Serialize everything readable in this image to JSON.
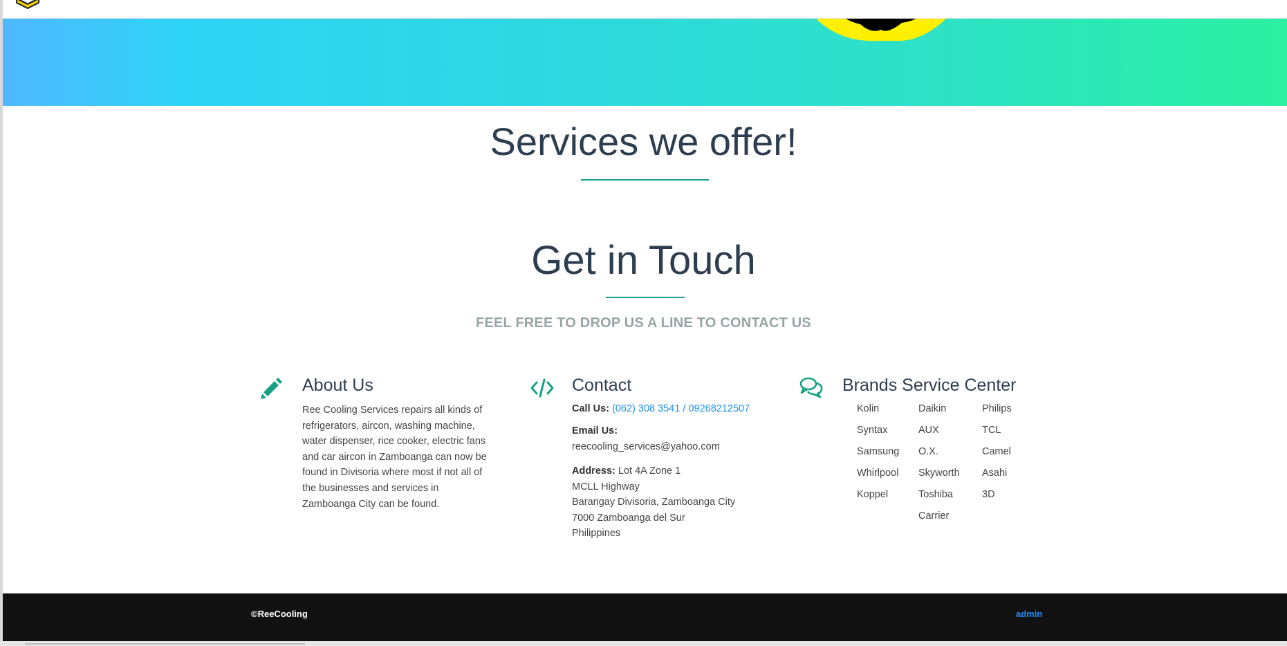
{
  "sections": {
    "services": {
      "title": "Services we offer!"
    },
    "contact": {
      "title": "Get in Touch",
      "subtitle": "FEEL FREE TO DROP US A LINE TO CONTACT US"
    }
  },
  "about": {
    "heading": "About Us",
    "text": "Ree Cooling Services repairs all kinds of refrigerators, aircon, washing machine, water dispenser, rice cooker, electric fans and car aircon in Zamboanga can now be found in Divisoria where most if not all of the businesses and services in Zamboanga City can be found.",
    "icon": "pencil-icon"
  },
  "contact_info": {
    "heading": "Contact",
    "icon": "code-icon",
    "call_label": "Call Us:",
    "call_value": "(062) 308 3541 / 09268212507",
    "email_label": "Email Us:",
    "email_value": "reecooling_services@yahoo.com",
    "address_label": "Address:",
    "address_line1": "Lot 4A Zone 1",
    "address_line2": "MCLL Highway",
    "address_line3": "Barangay Divisoria, Zamboanga City",
    "address_line4": "7000 Zamboanga del Sur",
    "address_line5": "Philippines"
  },
  "brands": {
    "heading": "Brands Service Center",
    "icon": "comments-icon",
    "col1": [
      "Kolin",
      "Syntax",
      "Samsung",
      "Whirlpool",
      "Koppel"
    ],
    "col2": [
      "Daikin",
      "AUX",
      "O.X.",
      "Skyworth",
      "Toshiba",
      "Carrier"
    ],
    "col3": [
      "Philips",
      "TCL",
      "Camel",
      "Asahi",
      "3D"
    ]
  },
  "footer": {
    "copyright": "©ReeCooling",
    "admin_link": "admin"
  },
  "colors": {
    "accent": "#16a085",
    "link": "#1e90e6",
    "heading": "#2c3e50",
    "footer_bg": "#111111"
  }
}
